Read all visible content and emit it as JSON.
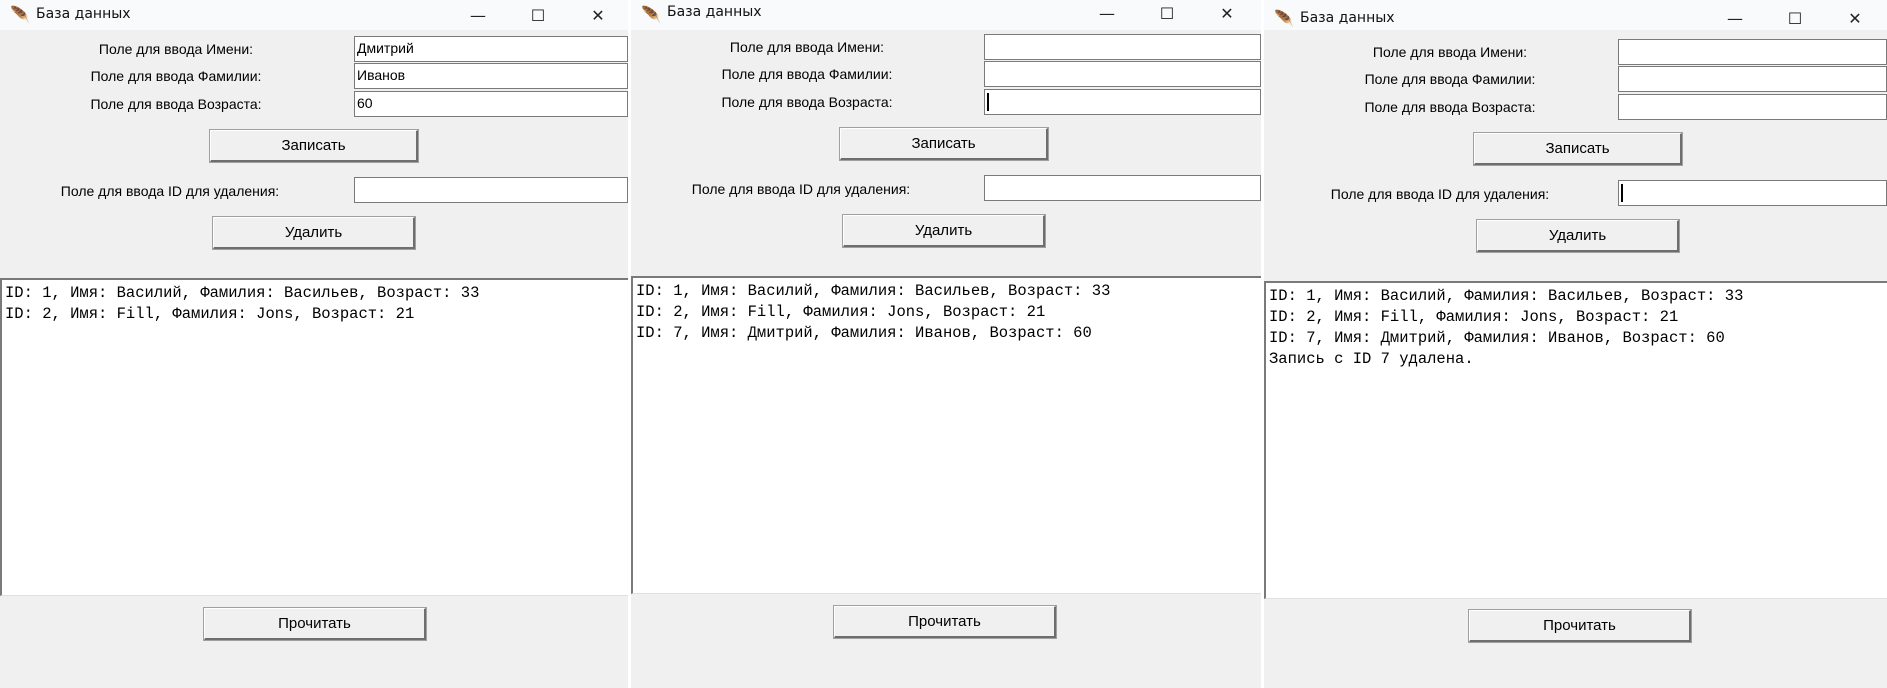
{
  "windows": [
    {
      "title": "База данных",
      "name_label": "Поле для ввода Имени:",
      "surname_label": "Поле для ввода Фамилии:",
      "age_label": "Поле для ввода Возраста:",
      "name_value": "Дмитрий",
      "surname_value": "Иванов",
      "age_value": "60",
      "write_button": "Записать",
      "delete_id_label": "Поле для ввода ID для удаления:",
      "delete_id_value": "",
      "delete_button": "Удалить",
      "output_lines": [
        "ID: 1, Имя: Василий, Фамилия: Васильев, Возраст: 33",
        "ID: 2, Имя: Fill, Фамилия: Jons, Возраст: 21"
      ],
      "read_button": "Прочитать"
    },
    {
      "title": "База данных",
      "name_label": "Поле для ввода Имени:",
      "surname_label": "Поле для ввода Фамилии:",
      "age_label": "Поле для ввода Возраста:",
      "name_value": "",
      "surname_value": "",
      "age_value": "",
      "write_button": "Записать",
      "delete_id_label": "Поле для ввода ID для удаления:",
      "delete_id_value": "",
      "delete_button": "Удалить",
      "output_lines": [
        "ID: 1, Имя: Василий, Фамилия: Васильев, Возраст: 33",
        "ID: 2, Имя: Fill, Фамилия: Jons, Возраст: 21",
        "ID: 7, Имя: Дмитрий, Фамилия: Иванов, Возраст: 60"
      ],
      "read_button": "Прочитать"
    },
    {
      "title": "База данных",
      "name_label": "Поле для ввода Имени:",
      "surname_label": "Поле для ввода Фамилии:",
      "age_label": "Поле для ввода Возраста:",
      "name_value": "",
      "surname_value": "",
      "age_value": "",
      "write_button": "Записать",
      "delete_id_label": "Поле для ввода ID для удаления:",
      "delete_id_value": "",
      "delete_button": "Удалить",
      "output_lines": [
        "ID: 1, Имя: Василий, Фамилия: Васильев, Возраст: 33",
        "ID: 2, Имя: Fill, Фамилия: Jons, Возраст: 21",
        "ID: 7, Имя: Дмитрий, Фамилия: Иванов, Возраст: 60",
        "Запись с ID 7 удалена."
      ],
      "read_button": "Прочитать"
    }
  ],
  "icons": {
    "app": "feather-icon",
    "minimize": "minimize-icon",
    "maximize": "maximize-icon",
    "close": "close-icon"
  },
  "colors": {
    "window_bg": "#f0f0f0",
    "titlebar_bg": "#f9fafb",
    "entry_bg": "#ffffff",
    "text": "#000000"
  }
}
